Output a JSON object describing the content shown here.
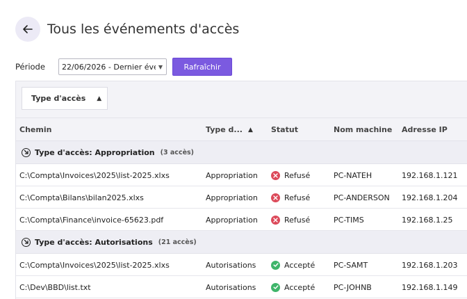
{
  "header": {
    "title": "Tous les événements d'accès"
  },
  "filter": {
    "period_label": "Période",
    "period_value": "22/06/2026 - Dernier évé...",
    "refresh_label": "Rafraîchir"
  },
  "grouping": {
    "chip_label": "Type d'accès"
  },
  "columns": {
    "path": "Chemin",
    "type": "Type d...",
    "status": "Statut",
    "machine": "Nom machine",
    "ip": "Adresse IP"
  },
  "groups": [
    {
      "title": "Type d'accès: Appropriation",
      "count": "(3 accès)",
      "rows": [
        {
          "path": "C:\\Compta\\Invoices\\2025\\list-2025.xlxs",
          "type": "Appropriation",
          "status": "Refusé",
          "status_kind": "refused",
          "machine": "PC-NATEH",
          "ip": "192.168.1.121"
        },
        {
          "path": "C:\\Compta\\Bilans\\bilan2025.xlxs",
          "type": "Appropriation",
          "status": "Refusé",
          "status_kind": "refused",
          "machine": "PC-ANDERSON",
          "ip": "192.168.1.204"
        },
        {
          "path": "C:\\Compta\\Finance\\invoice-65623.pdf",
          "type": "Appropriation",
          "status": "Refusé",
          "status_kind": "refused",
          "machine": "PC-TIMS",
          "ip": "192.168.1.25"
        }
      ]
    },
    {
      "title": "Type d'accès: Autorisations",
      "count": "(21 accès)",
      "rows": [
        {
          "path": "C:\\Compta\\Invoices\\2025\\list-2025.xlxs",
          "type": "Autorisations",
          "status": "Accepté",
          "status_kind": "accepted",
          "machine": "PC-SAMT",
          "ip": "192.168.1.203"
        },
        {
          "path": "C:\\Dev\\BBD\\list.txt",
          "type": "Autorisations",
          "status": "Accepté",
          "status_kind": "accepted",
          "machine": "PC-JOHNB",
          "ip": "192.168.1.149"
        }
      ]
    }
  ],
  "colors": {
    "accent": "#7b5ae0",
    "refused": "#dc4a5a",
    "accepted": "#3fb56a"
  }
}
